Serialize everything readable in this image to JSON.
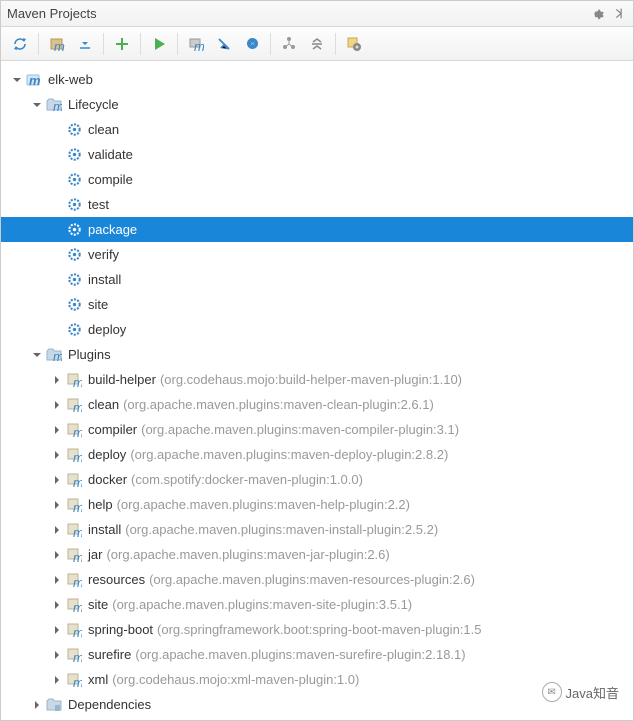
{
  "window": {
    "title": "Maven Projects"
  },
  "watermark": "Java知音",
  "toolbar": {
    "refresh": "refresh",
    "generate": "generate-sources",
    "download": "download",
    "add": "add",
    "run": "run",
    "debug": "debug",
    "skip_tests": "skip-tests",
    "offline": "offline",
    "show_deps": "show-dependencies",
    "collapse": "collapse-all",
    "settings": "settings"
  },
  "tree": {
    "root": {
      "label": "elk-web",
      "expanded": true,
      "children": {
        "lifecycle": {
          "label": "Lifecycle",
          "expanded": true,
          "goals": [
            "clean",
            "validate",
            "compile",
            "test",
            "package",
            "verify",
            "install",
            "site",
            "deploy"
          ],
          "selected": "package"
        },
        "plugins": {
          "label": "Plugins",
          "expanded": true,
          "items": [
            {
              "name": "build-helper",
              "coords": "(org.codehaus.mojo:build-helper-maven-plugin:1.10)"
            },
            {
              "name": "clean",
              "coords": "(org.apache.maven.plugins:maven-clean-plugin:2.6.1)"
            },
            {
              "name": "compiler",
              "coords": "(org.apache.maven.plugins:maven-compiler-plugin:3.1)"
            },
            {
              "name": "deploy",
              "coords": "(org.apache.maven.plugins:maven-deploy-plugin:2.8.2)"
            },
            {
              "name": "docker",
              "coords": "(com.spotify:docker-maven-plugin:1.0.0)"
            },
            {
              "name": "help",
              "coords": "(org.apache.maven.plugins:maven-help-plugin:2.2)"
            },
            {
              "name": "install",
              "coords": "(org.apache.maven.plugins:maven-install-plugin:2.5.2)"
            },
            {
              "name": "jar",
              "coords": "(org.apache.maven.plugins:maven-jar-plugin:2.6)"
            },
            {
              "name": "resources",
              "coords": "(org.apache.maven.plugins:maven-resources-plugin:2.6)"
            },
            {
              "name": "site",
              "coords": "(org.apache.maven.plugins:maven-site-plugin:3.5.1)"
            },
            {
              "name": "spring-boot",
              "coords": "(org.springframework.boot:spring-boot-maven-plugin:1.5"
            },
            {
              "name": "surefire",
              "coords": "(org.apache.maven.plugins:maven-surefire-plugin:2.18.1)"
            },
            {
              "name": "xml",
              "coords": "(org.codehaus.mojo:xml-maven-plugin:1.0)"
            }
          ]
        },
        "dependencies": {
          "label": "Dependencies",
          "expanded": false
        }
      }
    }
  }
}
